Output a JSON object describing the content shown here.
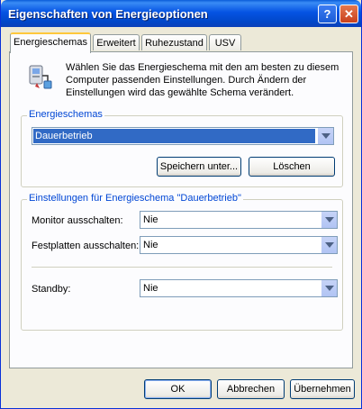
{
  "window": {
    "title": "Eigenschaften von Energieoptionen",
    "help_label": "?",
    "close_label": "✕"
  },
  "tabs": [
    {
      "label": "Energieschemas"
    },
    {
      "label": "Erweitert"
    },
    {
      "label": "Ruhezustand"
    },
    {
      "label": "USV"
    }
  ],
  "description": "Wählen Sie das Energieschema mit den am besten zu diesem Computer passenden Einstellungen. Durch Ändern der Einstellungen wird das gewählte Schema verändert.",
  "schemes": {
    "group_label": "Energieschemas",
    "selected": "Dauerbetrieb",
    "save_label": "Speichern unter...",
    "delete_label": "Löschen"
  },
  "settings": {
    "group_label": "Einstellungen für Energieschema \"Dauerbetrieb\"",
    "monitor_label": "Monitor ausschalten:",
    "monitor_value": "Nie",
    "disks_label": "Festplatten ausschalten:",
    "disks_value": "Nie",
    "standby_label": "Standby:",
    "standby_value": "Nie"
  },
  "footer": {
    "ok_label": "OK",
    "cancel_label": "Abbrechen",
    "apply_label": "Übernehmen"
  }
}
